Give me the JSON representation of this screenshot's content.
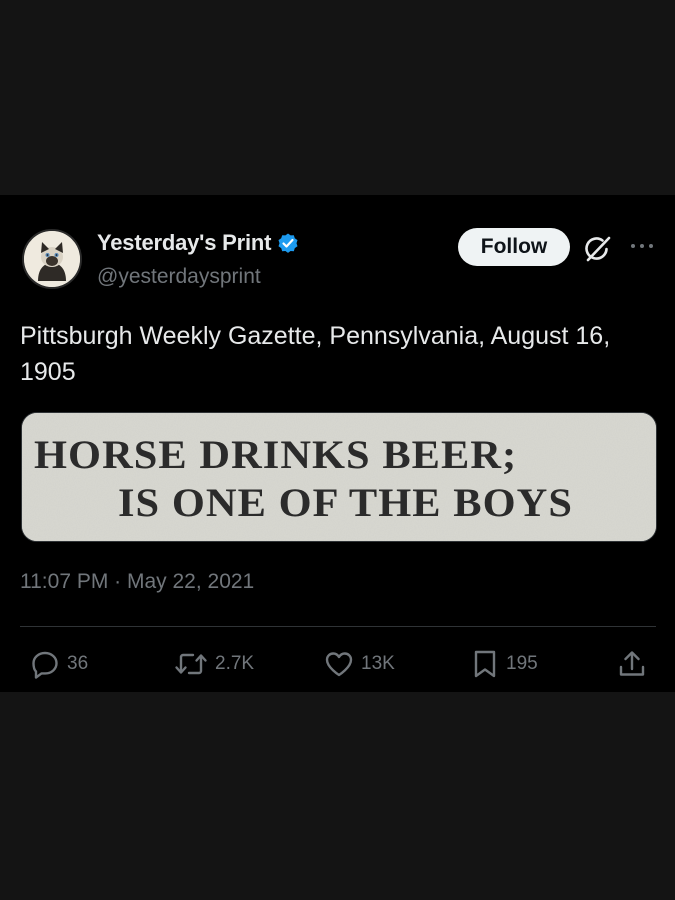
{
  "author": {
    "display_name": "Yesterday's Print",
    "handle": "@yesterdaysprint",
    "avatar_icon": "cat-avatar-icon",
    "verified_icon": "verified-badge-icon"
  },
  "header_actions": {
    "follow_label": "Follow",
    "grok_icon": "grok-icon",
    "more_icon": "more-options-icon"
  },
  "tweet": {
    "text": "Pittsburgh Weekly Gazette, Pennsylvania, August 16, 1905",
    "image": {
      "headline_line1": "HORSE DRINKS BEER;",
      "headline_line2": "IS ONE OF THE BOYS"
    },
    "timestamp": "11:07 PM · May 22, 2021"
  },
  "actions": {
    "replies": "36",
    "reposts": "2.7K",
    "likes": "13K",
    "bookmarks": "195",
    "share_icon": "share-icon"
  },
  "colors": {
    "background": "#000000",
    "outer_background": "#141414",
    "text_primary": "#e7e9ea",
    "text_secondary": "#71767b",
    "verified_blue": "#1d9bf0",
    "follow_button_bg": "#eff3f4"
  }
}
